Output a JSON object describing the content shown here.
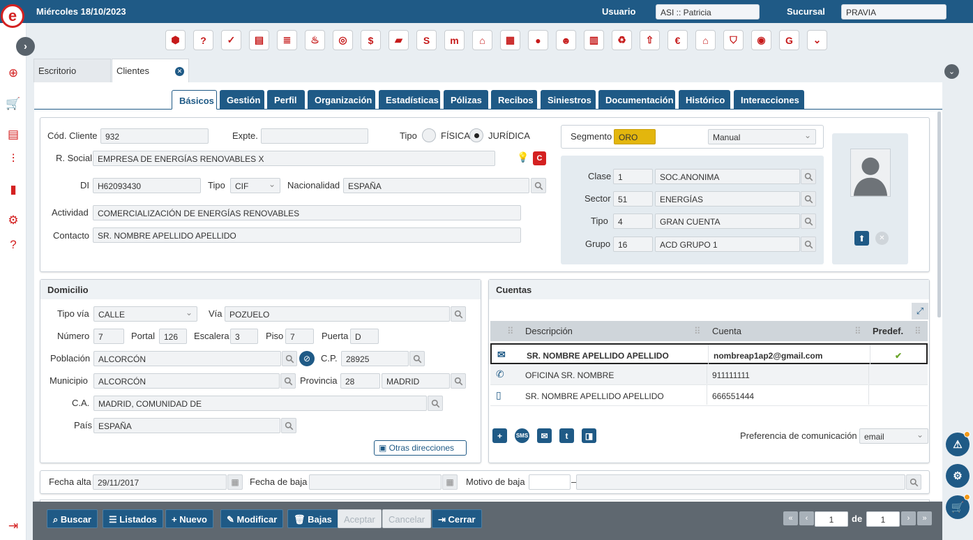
{
  "topbar": {
    "date": "Miércoles 18/10/2023",
    "user_label": "Usuario",
    "user_value": "ASI :: Patricia",
    "branch_label": "Sucursal",
    "branch_value": "PRAVIA"
  },
  "toolbar_icons": [
    "cube-icon",
    "user-question-icon",
    "user-check-icon",
    "documents-icon",
    "list-doc-icon",
    "flame-icon",
    "target-icon",
    "money-icon",
    "briefcase-icon",
    "bag-icon",
    "m-logo-icon",
    "house-doc-icon",
    "building-icon",
    "person-icon",
    "group-icon",
    "office-icon",
    "recycle-icon",
    "people-up-icon",
    "euro-icon",
    "house-euro-icon",
    "shield-icon",
    "eye-logo-icon",
    "g-logo-icon",
    "chevron-down-icon"
  ],
  "page_tabs": {
    "escritorio": "Escritorio",
    "clientes": "Clientes"
  },
  "sub_tabs": [
    "Básicos",
    "Gestión",
    "Perfil",
    "Organización",
    "Estadísticas",
    "Pólizas",
    "Recibos",
    "Siniestros",
    "Documentación",
    "Histórico",
    "Interacciones"
  ],
  "client": {
    "cod_label": "Cód. Cliente",
    "cod_value": "932",
    "expte_label": "Expte.",
    "expte_value": "",
    "tipo_label": "Tipo",
    "fisica": "FÍSICA",
    "juridica": "JURÍDICA",
    "rsocial_label": "R. Social",
    "rsocial_value": "EMPRESA DE ENERGÍAS RENOVABLES X",
    "di_label": "DI",
    "di_value": "H62093430",
    "tipodoc_label": "Tipo",
    "tipodoc_value": "CIF",
    "nac_label": "Nacionalidad",
    "nac_value": "ESPAÑA",
    "act_label": "Actividad",
    "act_value": "COMERCIALIZACIÓN DE ENERGÍAS RENOVABLES",
    "contacto_label": "Contacto",
    "contacto_value": "SR. NOMBRE APELLIDO APELLIDO"
  },
  "segment": {
    "label": "Segmento",
    "value": "ORO",
    "mode": "Manual",
    "clase_label": "Clase",
    "clase_code": "1",
    "clase_value": "SOC.ANONIMA",
    "sector_label": "Sector",
    "sector_code": "51",
    "sector_value": "ENERGÍAS",
    "tipo_label": "Tipo",
    "tipo_code": "4",
    "tipo_value": "GRAN CUENTA",
    "grupo_label": "Grupo",
    "grupo_code": "16",
    "grupo_value": "ACD GRUPO 1"
  },
  "domicilio": {
    "title": "Domicilio",
    "tipovia_label": "Tipo vía",
    "tipovia_value": "CALLE",
    "via_label": "Vía",
    "via_value": "POZUELO",
    "numero_label": "Número",
    "numero_value": "7",
    "portal_label": "Portal",
    "portal_value": "126",
    "escalera_label": "Escalera",
    "escalera_value": "3",
    "piso_label": "Piso",
    "piso_value": "7",
    "puerta_label": "Puerta",
    "puerta_value": "D",
    "poblacion_label": "Población",
    "poblacion_value": "ALCORCÓN",
    "cp_label": "C.P.",
    "cp_value": "28925",
    "municipio_label": "Municipio",
    "municipio_value": "ALCORCÓN",
    "provincia_label": "Provincia",
    "provincia_code": "28",
    "provincia_value": "MADRID",
    "ca_label": "C.A.",
    "ca_value": "MADRID, COMUNIDAD DE",
    "pais_label": "País",
    "pais_value": "ESPAÑA",
    "otras_label": "Otras direcciones"
  },
  "cuentas": {
    "title": "Cuentas",
    "col_desc": "Descripción",
    "col_cuenta": "Cuenta",
    "col_predef": "Predef.",
    "rows": [
      {
        "icon": "email-icon",
        "desc": "SR. NOMBRE APELLIDO APELLIDO",
        "cuenta": "nombreap1ap2@gmail.com",
        "predef": "✔"
      },
      {
        "icon": "phone-icon",
        "desc": "OFICINA SR. NOMBRE",
        "cuenta": "911111111",
        "predef": ""
      },
      {
        "icon": "mobile-icon",
        "desc": "SR. NOMBRE APELLIDO APELLIDO",
        "cuenta": "666551444",
        "predef": ""
      }
    ],
    "pref_label": "Preferencia de comunicación",
    "pref_value": "email"
  },
  "fechas": {
    "alta_label": "Fecha alta",
    "alta_value": "29/11/2017",
    "baja_label": "Fecha de baja",
    "baja_value": "",
    "motivo_label": "Motivo de baja",
    "motivo_code": "",
    "motivo_sep": "–",
    "motivo_value": ""
  },
  "actions": {
    "buscar": "Buscar",
    "listados": "Listados",
    "nuevo": "Nuevo",
    "modificar": "Modificar",
    "bajas": "Bajas",
    "aceptar": "Aceptar",
    "cancelar": "Cancelar",
    "cerrar": "Cerrar"
  },
  "pager": {
    "current": "1",
    "of_label": "de",
    "total": "1"
  },
  "colors": {
    "primary": "#1f5a86",
    "brand_red": "#d42121",
    "segment_gold": "#e3b60d",
    "notify": "#f39a1a"
  }
}
